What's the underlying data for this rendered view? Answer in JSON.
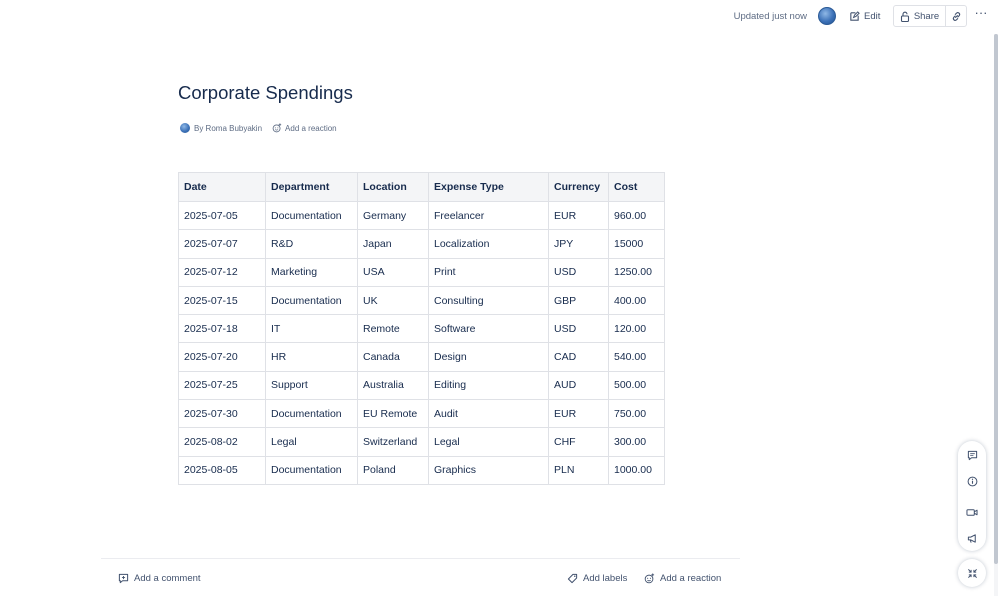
{
  "header": {
    "updated": "Updated just now",
    "edit_label": "Edit",
    "share_label": "Share",
    "more": "···"
  },
  "page": {
    "title": "Corporate Spendings",
    "byline": "By Roma Bubyakin",
    "add_reaction": "Add a reaction"
  },
  "table": {
    "headers": [
      "Date",
      "Department",
      "Location",
      "Expense Type",
      "Currency",
      "Cost"
    ],
    "rows": [
      [
        "2025-07-05",
        "Documentation",
        "Germany",
        "Freelancer",
        "EUR",
        "960.00"
      ],
      [
        "2025-07-07",
        "R&D",
        "Japan",
        "Localization",
        "JPY",
        "15000"
      ],
      [
        "2025-07-12",
        "Marketing",
        "USA",
        "Print",
        "USD",
        "1250.00"
      ],
      [
        "2025-07-15",
        "Documentation",
        "UK",
        "Consulting",
        "GBP",
        "400.00"
      ],
      [
        "2025-07-18",
        "IT",
        "Remote",
        "Software",
        "USD",
        "120.00"
      ],
      [
        "2025-07-20",
        "HR",
        "Canada",
        "Design",
        "CAD",
        "540.00"
      ],
      [
        "2025-07-25",
        "Support",
        "Australia",
        "Editing",
        "AUD",
        "500.00"
      ],
      [
        "2025-07-30",
        "Documentation",
        "EU Remote",
        "Audit",
        "EUR",
        "750.00"
      ],
      [
        "2025-08-02",
        "Legal",
        "Switzerland",
        "Legal",
        "CHF",
        "300.00"
      ],
      [
        "2025-08-05",
        "Documentation",
        "Poland",
        "Graphics",
        "PLN",
        "1000.00"
      ]
    ]
  },
  "footer": {
    "add_comment": "Add a comment",
    "add_labels": "Add labels",
    "add_reaction": "Add a reaction"
  },
  "icons": {
    "edit": "pencil-icon",
    "share": "lock-icon",
    "link": "link-icon",
    "comment": "comment-icon",
    "info": "info-icon",
    "video": "video-icon",
    "announce": "megaphone-icon",
    "collapse": "collapse-icon",
    "label": "tag-icon",
    "reaction": "emoji-add-icon"
  },
  "colors": {
    "text": "#172b4d",
    "muted": "#5e6c84",
    "border": "#dfe1e6",
    "header_bg": "#f4f5f7"
  }
}
